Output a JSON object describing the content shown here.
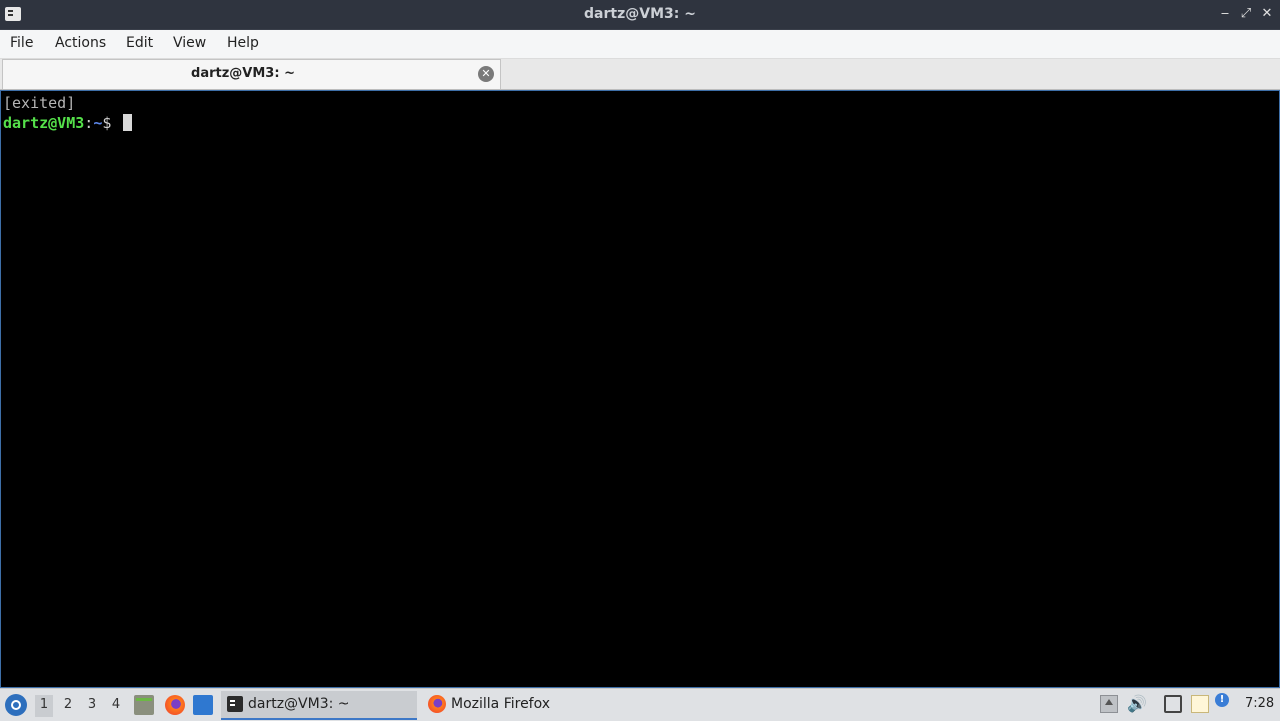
{
  "window": {
    "title": "dartz@VM3: ~",
    "app_icon": "terminal-icon",
    "buttons": {
      "minimize": "‒",
      "maximize": "⤢",
      "close": "✕"
    }
  },
  "menubar": {
    "items": [
      "File",
      "Actions",
      "Edit",
      "View",
      "Help"
    ]
  },
  "tabs": [
    {
      "label": "dartz@VM3: ~",
      "close_icon": "close-circle-icon",
      "active": true
    }
  ],
  "terminal": {
    "lines": [
      "[exited]"
    ],
    "prompt": {
      "user_host": "dartz@VM3",
      "separator": ":",
      "path": "~",
      "symbol": "$"
    },
    "colors": {
      "user_host": "#55e04a",
      "path": "#5c86e8",
      "background": "#000000"
    }
  },
  "taskbar": {
    "workspaces": [
      "1",
      "2",
      "3",
      "4"
    ],
    "active_workspace": "1",
    "launchers": [
      "file-manager-icon",
      "firefox-icon",
      "show-desktop-icon"
    ],
    "tasks": [
      {
        "label": "dartz@VM3: ~",
        "icon": "terminal-icon",
        "active": true
      },
      {
        "label": "Mozilla Firefox",
        "icon": "firefox-icon",
        "active": false
      }
    ],
    "tray": [
      "eject-icon",
      "volume-icon",
      "network-icon",
      "clipboard-icon",
      "notification-icon"
    ],
    "clock": "7:28"
  }
}
